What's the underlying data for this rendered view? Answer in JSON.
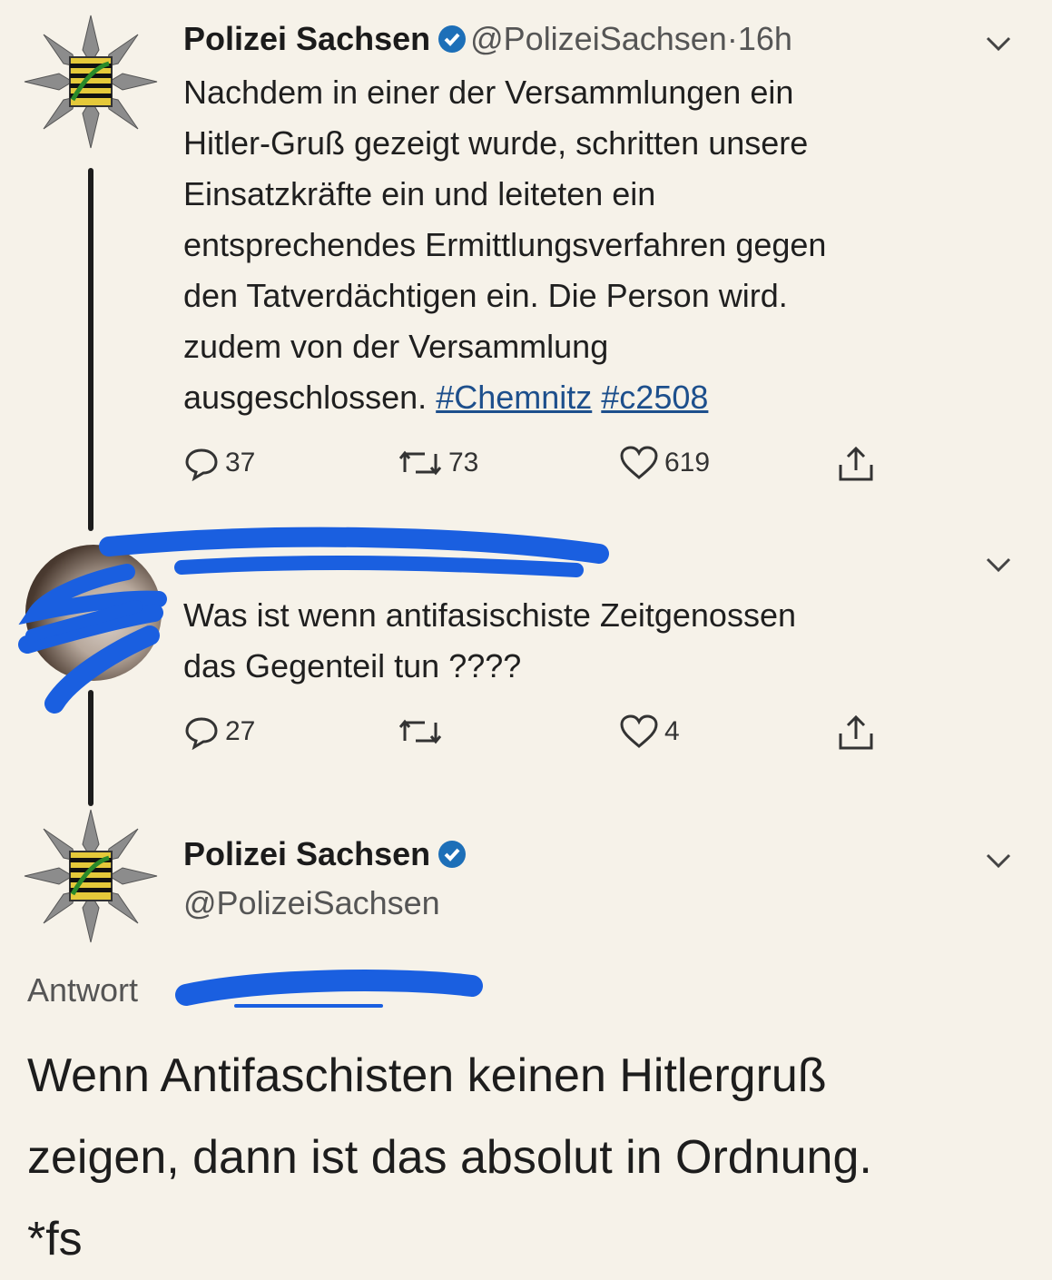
{
  "tweet1": {
    "name": "Polizei Sachsen",
    "handle": "@PolizeiSachsen",
    "dot": "·",
    "time": "16h",
    "text_lines": [
      "Nachdem in einer der Versammlungen ein",
      "Hitler-Gruß gezeigt wurde, schritten unsere",
      "Einsatzkräfte ein und leiteten ein",
      "entsprechendes Ermittlungsverfahren gegen",
      "den Tatverdächtigen ein. Die Person wird.",
      "zudem von der Versammlung"
    ],
    "last_line_text": "ausgeschlossen.",
    "hashtags": [
      "#Chemnitz",
      "#c2508"
    ],
    "actions": {
      "replies": "37",
      "retweets": "73",
      "likes": "619"
    }
  },
  "tweet2": {
    "text_lines": [
      "Was ist wenn antifasischiste Zeitgenossen",
      "das Gegenteil tun ????"
    ],
    "actions": {
      "replies": "27",
      "retweets": "",
      "likes": "4"
    }
  },
  "tweet3": {
    "name": "Polizei Sachsen",
    "handle": "@PolizeiSachsen",
    "reply_label": "Antwort",
    "text_lines": [
      "Wenn Antifaschisten keinen Hitlergruß",
      "zeigen, dann ist das absolut in Ordnung.",
      "*fs"
    ]
  },
  "colors": {
    "background": "#f6f2e9",
    "verified": "#1d6fb8",
    "hashtag": "#1d4f8c",
    "redaction": "#1a5fe0"
  },
  "icons": [
    "police-star-icon",
    "verified-icon",
    "chevron-down-icon",
    "reply-icon",
    "retweet-icon",
    "like-icon",
    "share-icon"
  ]
}
